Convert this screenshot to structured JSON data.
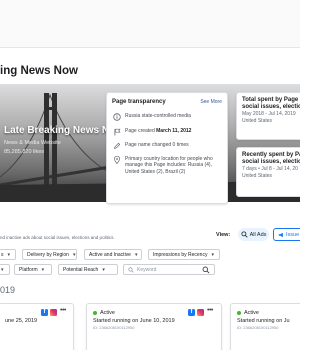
{
  "header": {
    "title": "ing News Now"
  },
  "cover": {
    "name": "Late Breaking News Now",
    "category": "News & Media Website",
    "likes": "85,285,820 likes"
  },
  "transparency": {
    "title": "Page transparency",
    "see_more": "See More",
    "rows": [
      {
        "icon": "info-icon",
        "text": "Russia state-controlled media"
      },
      {
        "icon": "flag-icon",
        "prefix": "Page created ",
        "bold": "March 11, 2012"
      },
      {
        "icon": "edit-icon",
        "text": "Page name changed 0 times"
      },
      {
        "icon": "location-icon",
        "text": "Primary country location for people who manage this Page includes: Russia (4), United States (2), Brazil (2)"
      }
    ]
  },
  "spend_total": {
    "title_1": "Total spent by Page o",
    "title_2": "social issues, electio",
    "dates": "May 2018 - Jul 14, 2019",
    "country": "United States"
  },
  "spend_recent": {
    "title_1": "Recently spent by Pa",
    "title_2": "social issues, electio",
    "dates": "7 days • Jul 8 - Jul 14, 20",
    "country": "United States"
  },
  "intro": "nd inactive ads about social issues, elections and politics.",
  "view": {
    "label": "View:",
    "all_ads": "All Ads",
    "issue": "Issue"
  },
  "filters": {
    "row1": [
      "s",
      "Delivery by Region",
      "Active and Inactive",
      "Impressions by Recency"
    ],
    "row2": [
      "",
      "Platform",
      "Potential Reach"
    ],
    "search_placeholder": "Keyword"
  },
  "year": "019",
  "ads": [
    {
      "status": "",
      "started": "une 25, 2019",
      "id": ""
    },
    {
      "status": "Active",
      "started": "Started running on June 10, 2019",
      "id": "ID: 2366208100112950"
    },
    {
      "status": "Active",
      "started": "Started running on Ju",
      "id": "ID: 2366208100112950"
    }
  ],
  "colors": {
    "link": "#385898",
    "accent": "#1877f2",
    "active_dot": "#42b72a"
  }
}
